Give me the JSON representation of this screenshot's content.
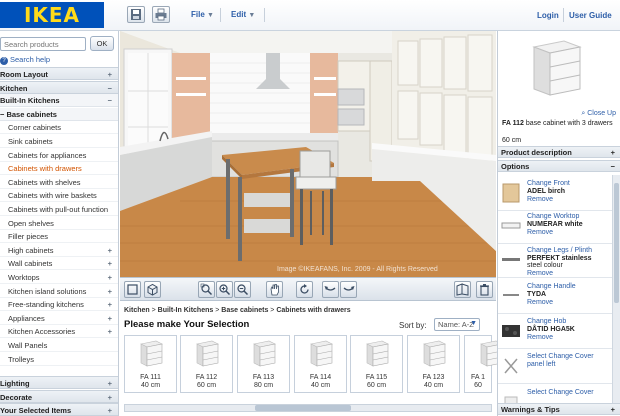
{
  "brand": {
    "logo_text": "IKEA",
    "logo_bg": "#0051ba",
    "logo_fg": "#ffda1a",
    "accent": "#2d5ea8",
    "selected": "#d35400"
  },
  "toolbar": {
    "save_icon": "save-icon",
    "print_icon": "print-icon",
    "file_label": "File",
    "edit_label": "Edit",
    "login_label": "Login",
    "user_guide_label": "User Guide"
  },
  "sidebar": {
    "search_placeholder": "Search products",
    "ok_label": "OK",
    "search_help_label": "Search help",
    "rows": [
      {
        "label": "Room Layout",
        "kind": "hdr",
        "sign": "+"
      },
      {
        "label": "Kitchen",
        "kind": "hdr",
        "sign": "−"
      },
      {
        "label": "Built-In Kitchens",
        "kind": "sub",
        "sign": "−"
      },
      {
        "label": "− Base cabinets",
        "kind": "sub",
        "sign": ""
      },
      {
        "label": "Corner cabinets",
        "kind": "item",
        "sign": ""
      },
      {
        "label": "Sink cabinets",
        "kind": "item",
        "sign": ""
      },
      {
        "label": "Cabinets for appliances",
        "kind": "item",
        "sign": ""
      },
      {
        "label": "Cabinets with drawers",
        "kind": "sel",
        "sign": ""
      },
      {
        "label": "Cabinets with shelves",
        "kind": "item",
        "sign": ""
      },
      {
        "label": "Cabinets with wire baskets",
        "kind": "item",
        "sign": ""
      },
      {
        "label": "Cabinets with pull-out function",
        "kind": "item",
        "sign": ""
      },
      {
        "label": "Open shelves",
        "kind": "item",
        "sign": ""
      },
      {
        "label": "Filler pieces",
        "kind": "item",
        "sign": ""
      },
      {
        "label": "High cabinets",
        "kind": "item",
        "sign": "+"
      },
      {
        "label": "Wall cabinets",
        "kind": "item",
        "sign": "+"
      },
      {
        "label": "Worktops",
        "kind": "item",
        "sign": "+"
      },
      {
        "label": "Kitchen island solutions",
        "kind": "item",
        "sign": "+"
      },
      {
        "label": "Free-standing kitchens",
        "kind": "item",
        "sign": "+"
      },
      {
        "label": "Appliances",
        "kind": "item",
        "sign": "+"
      },
      {
        "label": "Kitchen Accessories",
        "kind": "item",
        "sign": "+"
      },
      {
        "label": "Wall Panels",
        "kind": "item",
        "sign": ""
      },
      {
        "label": "Trolleys",
        "kind": "item",
        "sign": ""
      },
      {
        "label": "Lighting",
        "kind": "hdr",
        "sign": "+"
      },
      {
        "label": "Decorate",
        "kind": "hdr",
        "sign": "+"
      },
      {
        "label": "Your Selected Items",
        "kind": "hdr",
        "sign": "+"
      }
    ]
  },
  "scene": {
    "copyright": "Image ©IKEAFANS, Inc. 2009 - All Rights Reserved"
  },
  "view_toolbar": {
    "buttons": [
      "2d-view-icon",
      "3d-view-icon",
      "zoom-fit-icon",
      "zoom-in-icon",
      "zoom-out-icon",
      "pan-hand-icon",
      "rotate-icon",
      "rotate-left-icon",
      "rotate-right-icon",
      "camera-view-icon",
      "trash-icon"
    ]
  },
  "selection": {
    "breadcrumb": [
      "Kitchen",
      "Built-In Kitchens",
      "Base cabinets",
      "Cabinets with drawers"
    ],
    "breadcrumb_sep": " > ",
    "heading": "Please make Your Selection",
    "sort_label": "Sort by:",
    "sort_value": "Name: A-Z",
    "items": [
      {
        "code": "FA 111",
        "size": "40 cm"
      },
      {
        "code": "FA 112",
        "size": "60 cm"
      },
      {
        "code": "FA 113",
        "size": "80 cm"
      },
      {
        "code": "FA 114",
        "size": "40 cm"
      },
      {
        "code": "FA 115",
        "size": "60 cm"
      },
      {
        "code": "FA 123",
        "size": "40 cm"
      },
      {
        "code": "FA 1",
        "size": "60"
      }
    ]
  },
  "product": {
    "close_up": "Close Up",
    "code": "FA 112",
    "name": "base cabinet with 3 drawers",
    "size": "60 cm",
    "desc_header": "Product description",
    "options_header": "Options",
    "warnings_header": "Warnings & Tips",
    "options": [
      {
        "l1": "Change Front",
        "l2": "ADEL birch",
        "l3": "Remove"
      },
      {
        "l1": "Change Worktop",
        "l2": "NUMERAR white",
        "l3": "Remove"
      },
      {
        "l1": "Change Legs / Plinth",
        "l2": "PERFEKT stainless",
        "l2b": "steel colour",
        "l3": "Remove"
      },
      {
        "l1": "Change Handle",
        "l2": "TYDA",
        "l3": "Remove"
      },
      {
        "l1": "Change Hob",
        "l2": "DÅTID HGA5K",
        "l3": "Remove"
      },
      {
        "l1": "Select Change Cover",
        "l2": "panel left",
        "l3": ""
      },
      {
        "l1": "Select Change Cover",
        "l2": "",
        "l3": ""
      }
    ]
  }
}
